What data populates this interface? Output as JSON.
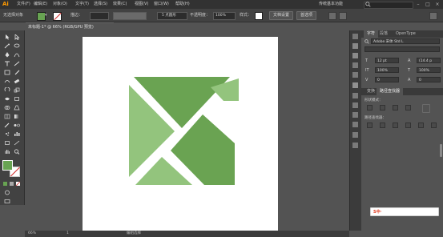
{
  "app": {
    "logo": "Ai"
  },
  "menu": {
    "items": [
      "文件(F)",
      "编辑(E)",
      "对象(O)",
      "文字(T)",
      "选择(S)",
      "效果(C)",
      "视图(V)",
      "窗口(W)",
      "帮助(H)"
    ],
    "workspace": "传统基本功能"
  },
  "control": {
    "selection_label": "无选择对象",
    "stroke_label": "描边：",
    "brush_value": "5 点圆形",
    "opacity_label": "不透明度：",
    "opacity_value": "100%",
    "style_label": "样式：",
    "doc_setup_button": "文档设置",
    "prefs_button": "首选项"
  },
  "document": {
    "tab_title": "未标题-1* @ 66% (RGB/GPU 预览)",
    "zoom": "66%",
    "page": "1",
    "status_tool": "编组选择"
  },
  "artwork": {
    "colors": {
      "light": "#93c47d",
      "dark": "#6aa352",
      "fill": "#68a352"
    }
  },
  "character_panel": {
    "tabs": [
      "字符",
      "段落",
      "OpenType"
    ],
    "font_name": "Adobe 宋体 Std L",
    "font_size": "12 pt",
    "leading": "(14.4 p",
    "scale_h": "100%",
    "scale_v": "100%",
    "tracking": "0",
    "kerning": "0",
    "baseline": "自动",
    "rotation": "0°"
  },
  "pathfinder_panel": {
    "tabs": [
      "变换",
      "路径查找器"
    ],
    "shape_modes_label": "形状模式：",
    "pathfinders_label": "路径查找器："
  },
  "ime": {
    "label": "S中·"
  }
}
